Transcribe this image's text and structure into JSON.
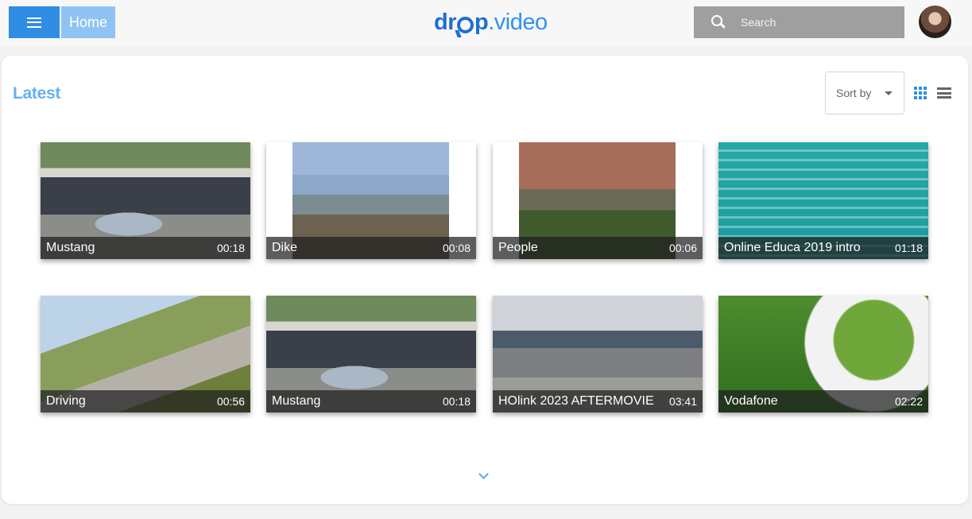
{
  "header": {
    "home_label": "Home",
    "logo_brand": "dr",
    "logo_rest": "p",
    "logo_tld": ".video",
    "search_placeholder": "Search"
  },
  "section": {
    "title": "Latest",
    "sort_label": "Sort by"
  },
  "videos": [
    {
      "title": "Mustang",
      "duration": "00:18"
    },
    {
      "title": "Dike",
      "duration": "00:08"
    },
    {
      "title": "People",
      "duration": "00:06"
    },
    {
      "title": "Online Educa 2019 intro",
      "duration": "01:18"
    },
    {
      "title": "Driving",
      "duration": "00:56"
    },
    {
      "title": "Mustang",
      "duration": "00:18"
    },
    {
      "title": "HOlink 2023 AFTERMOVIE",
      "duration": "03:41"
    },
    {
      "title": "Vodafone",
      "duration": "02:22"
    }
  ],
  "colors": {
    "accent": "#2f8de4",
    "home_bg": "#8ec3f4",
    "title": "#64b0f0",
    "search_bg": "#9f9f9f"
  },
  "icons": [
    "menu-icon",
    "search-icon",
    "grid-view-icon",
    "list-view-icon",
    "chevron-down-icon",
    "caret-down-icon"
  ]
}
